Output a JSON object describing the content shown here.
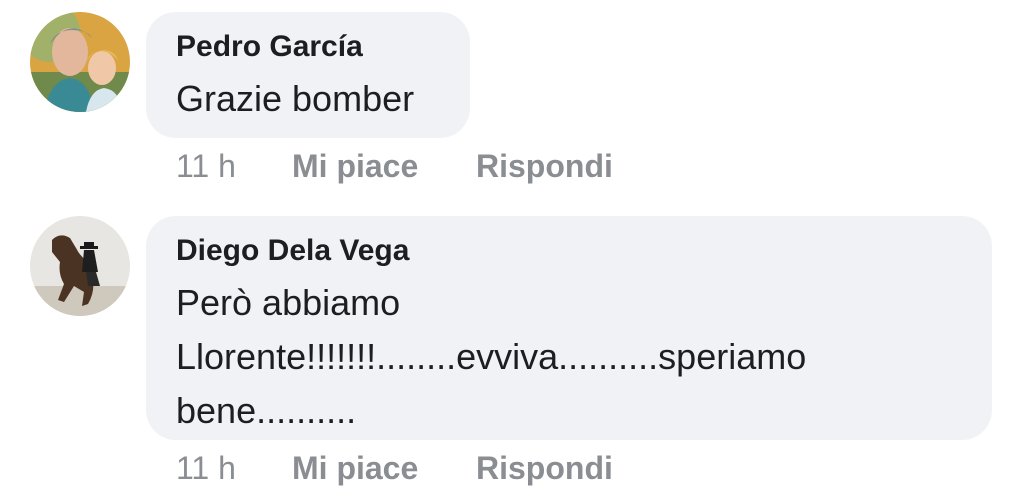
{
  "comments": [
    {
      "author": "Pedro García",
      "text": "Grazie bomber",
      "time": "11 h",
      "like_label": "Mi piace",
      "reply_label": "Rispondi"
    },
    {
      "author": "Diego Dela Vega",
      "text": "Però abbiamo Llorente!!!!!!!........evviva..........speriamo bene..........",
      "time": "11 h",
      "like_label": "Mi piace",
      "reply_label": "Rispondi"
    }
  ],
  "colors": {
    "bubble": "#f0f2f5",
    "text": "#1c1e21",
    "meta": "#8a8d91"
  }
}
